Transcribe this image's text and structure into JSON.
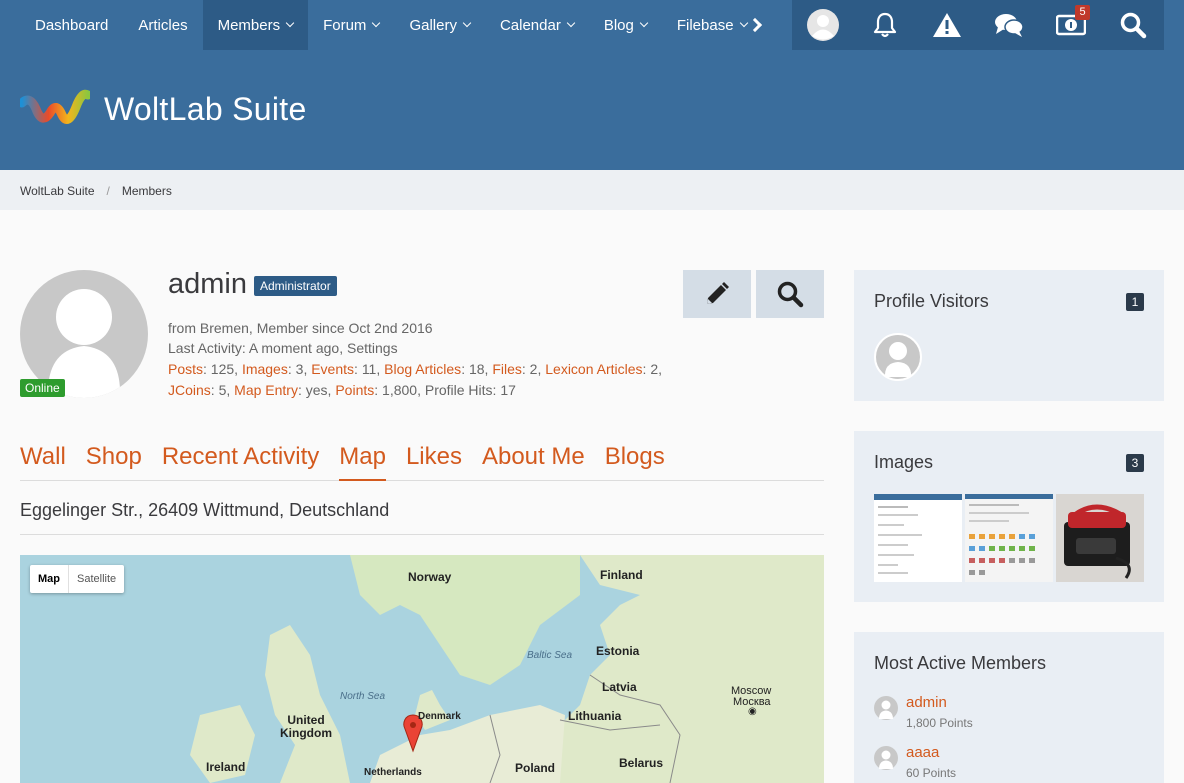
{
  "nav": {
    "items": [
      {
        "label": "Dashboard",
        "dropdown": false
      },
      {
        "label": "Articles",
        "dropdown": false
      },
      {
        "label": "Members",
        "dropdown": true,
        "active": true
      },
      {
        "label": "Forum",
        "dropdown": true
      },
      {
        "label": "Gallery",
        "dropdown": true
      },
      {
        "label": "Calendar",
        "dropdown": true
      },
      {
        "label": "Blog",
        "dropdown": true
      },
      {
        "label": "Filebase",
        "dropdown": true
      }
    ],
    "notifications_count": "5"
  },
  "header": {
    "logo_text": "WoltLab Suite"
  },
  "breadcrumb": [
    "WoltLab Suite",
    "Members"
  ],
  "profile": {
    "username": "admin",
    "rank": "Administrator",
    "status": "Online",
    "line1": {
      "from": "from Bremen",
      "member_since": "Member since Oct 2nd 2016"
    },
    "line2": {
      "last_activity": "Last Activity: A moment ago",
      "activity": "Settings"
    },
    "stats": {
      "posts_label": "Posts",
      "posts": "125",
      "images_label": "Images",
      "images": "3",
      "events_label": "Events",
      "events": "11",
      "blog_articles_label": "Blog Articles",
      "blog_articles": "18",
      "files_label": "Files",
      "files": "2",
      "lexicon_label": "Lexicon Articles",
      "lexicon": "2",
      "jcoins_label": "JCoins",
      "jcoins": "5",
      "map_entry_label": "Map Entry",
      "map_entry": "yes",
      "points_label": "Points",
      "points": "1,800",
      "profile_hits": "Profile Hits: 17"
    }
  },
  "tabs": [
    "Wall",
    "Shop",
    "Recent Activity",
    "Map",
    "Likes",
    "About Me",
    "Blogs"
  ],
  "active_tab": "Map",
  "address": "Eggelinger Str., 26409 Wittmund, Deutschland",
  "map": {
    "type_map": "Map",
    "type_satellite": "Satellite",
    "labels": {
      "norway": "Norway",
      "finland": "Finland",
      "estonia": "Estonia",
      "latvia": "Latvia",
      "lithuania": "Lithuania",
      "denmark": "Denmark",
      "uk": "United Kingdom",
      "ireland": "Ireland",
      "netherlands": "Netherlands",
      "poland": "Poland",
      "belarus": "Belarus",
      "moscow": "Moscow",
      "moscow_local": "Москва",
      "baltic": "Baltic Sea",
      "northsea": "North Sea"
    }
  },
  "sidebar": {
    "visitors": {
      "title": "Profile Visitors",
      "count": "1"
    },
    "images": {
      "title": "Images",
      "count": "3"
    },
    "active_members": {
      "title": "Most Active Members",
      "members": [
        {
          "name": "admin",
          "points": "1,800 Points"
        },
        {
          "name": "aaaa",
          "points": "60 Points"
        }
      ]
    }
  },
  "colors": {
    "nav": "#3a6d9c",
    "nav_dark": "#2d5b86",
    "link": "#d35a1e",
    "online": "#2e9c2e",
    "sidebar": "#e9eef4"
  }
}
